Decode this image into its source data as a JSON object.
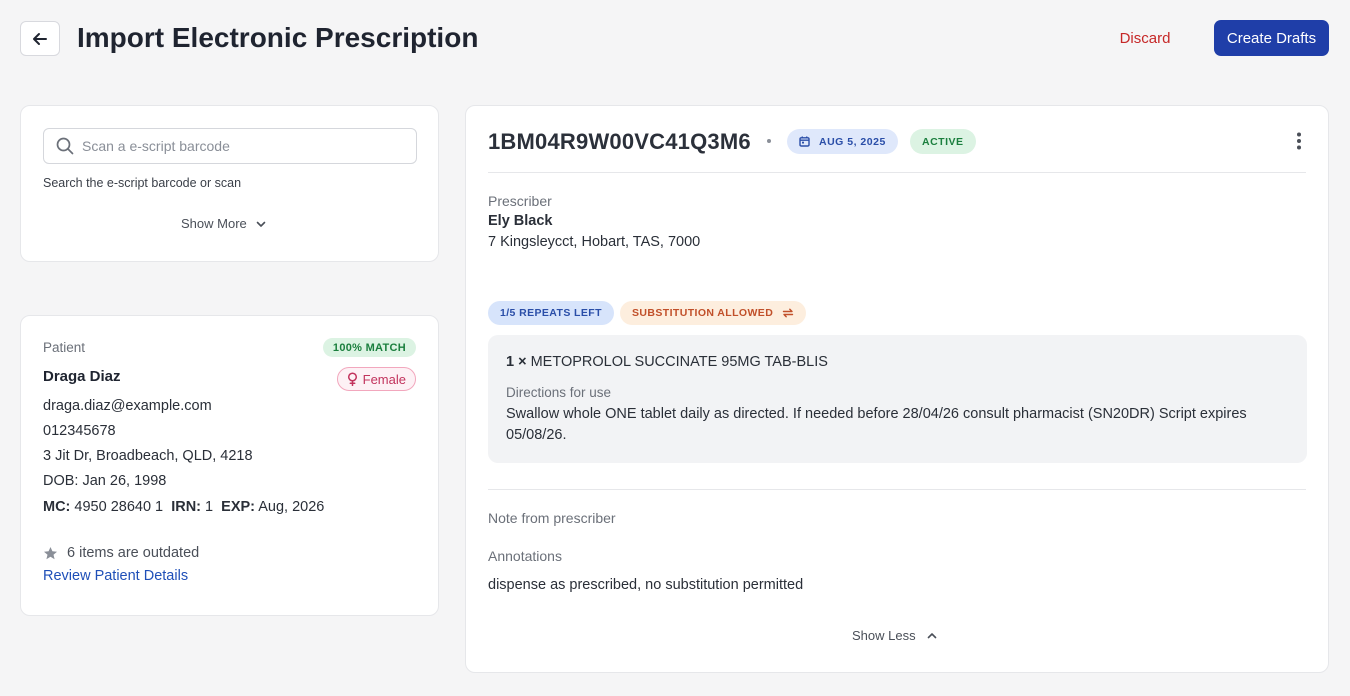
{
  "header": {
    "title": "Import Electronic Prescription",
    "discard_label": "Discard",
    "create_label": "Create Drafts"
  },
  "search": {
    "placeholder": "Scan a e-script barcode",
    "hint": "Search the e-script barcode or scan",
    "show_more_label": "Show More"
  },
  "patient": {
    "section_label": "Patient",
    "match": "100% MATCH",
    "name": "Draga Diaz",
    "gender": "Female",
    "email": "draga.diaz@example.com",
    "phone": "012345678",
    "address": "3 Jit Dr, Broadbeach, QLD, 4218",
    "dob": "DOB: Jan 26, 1998",
    "mc_label": "MC:",
    "mc_value": "4950 28640 1",
    "irn_label": "IRN:",
    "irn_value": "1",
    "exp_label": "EXP:",
    "exp_value": "Aug, 2026",
    "outdated": "6 items are outdated",
    "review_link": "Review Patient Details"
  },
  "prescription": {
    "id": "1BM04R9W00VC41Q3M6",
    "date": "AUG 5, 2025",
    "status": "ACTIVE",
    "prescriber_label": "Prescriber",
    "prescriber_name": "Ely Black",
    "prescriber_address": "7 Kingsleycct, Hobart, TAS, 7000",
    "repeats": "1/5 REPEATS LEFT",
    "substitution": "SUBSTITUTION ALLOWED",
    "quantity": "1 ×",
    "medication": "METOPROLOL SUCCINATE 95MG TAB-BLIS",
    "directions_label": "Directions for use",
    "directions": "Swallow whole ONE tablet daily as directed. If needed before 28/04/26 consult pharmacist (SN20DR) Script expires 05/08/26.",
    "note_label": "Note from prescriber",
    "annotations_label": "Annotations",
    "annotations": "dispense as prescribed, no substitution permitted",
    "show_less_label": "Show Less"
  },
  "colors": {
    "primary": "#1f3ea8",
    "danger": "#c62828",
    "success_bg": "#dcf3e3",
    "success_text": "#1b7f3e",
    "info_bg": "#dfe8fb",
    "warning_bg": "#fdeede",
    "warning_text": "#c1502a"
  },
  "icons": {
    "back": "arrow-left-icon",
    "search": "search-icon",
    "chevron_down": "chevron-down-icon",
    "chevron_up": "chevron-up-icon",
    "female": "female-icon",
    "star": "star-icon",
    "calendar": "calendar-icon",
    "swap": "swap-icon",
    "kebab": "more-vertical-icon"
  }
}
